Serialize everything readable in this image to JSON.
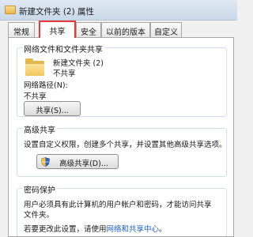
{
  "window": {
    "title": "新建文件夹 (2) 属性"
  },
  "tabs": [
    {
      "label": "常规"
    },
    {
      "label": "共享"
    },
    {
      "label": "安全"
    },
    {
      "label": "以前的版本"
    },
    {
      "label": "自定义"
    }
  ],
  "active_tab": "共享",
  "network_sharing": {
    "heading": "网络文件和文件夹共享",
    "folder_name": "新建文件夹  (2)",
    "folder_status": "不共享",
    "path_label": "网络路径(N):",
    "path_value": "不共享",
    "share_button": "共享(S)..."
  },
  "advanced_sharing": {
    "heading": "高级共享",
    "description": "设置自定义权限，创建多个共享，并设置其他高级共享选项。",
    "button": "高级共享(D)..."
  },
  "password_protection": {
    "heading": "密码保护",
    "description_line1": "用户必须具有此计算机的用户帐户和密码，才能访问共享",
    "description_line2": "文件夹。",
    "change_prefix": "若要更改此设置，请使用",
    "link_text": "网络和共享中心",
    "change_suffix": "。"
  },
  "icons": [
    "folder-icon",
    "shield-icon"
  ],
  "colors": {
    "active_tab_highlight": "#e8393b",
    "link": "#1d5fc9"
  }
}
